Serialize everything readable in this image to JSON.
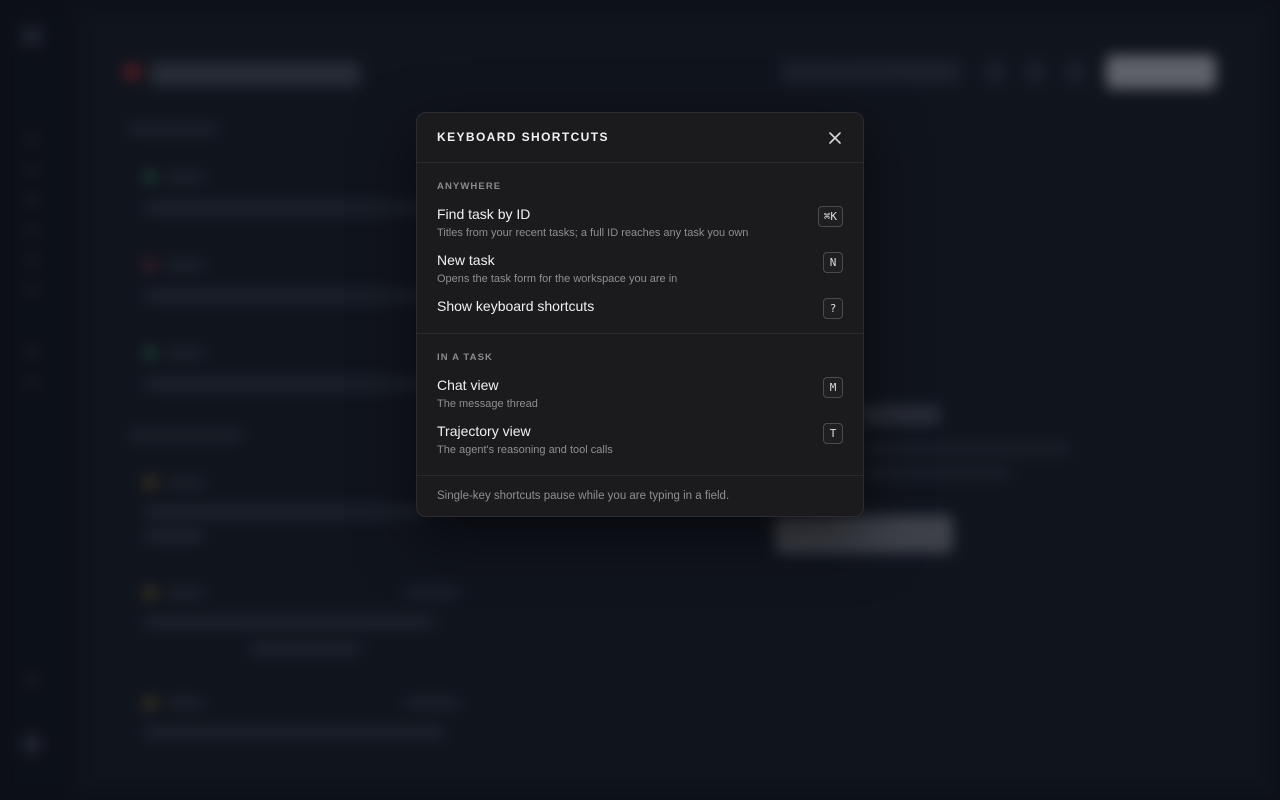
{
  "modal": {
    "title": "KEYBOARD SHORTCUTS",
    "close_icon": "close-icon",
    "sections": [
      {
        "label": "ANYWHERE",
        "items": [
          {
            "title": "Find task by ID",
            "description": "Titles from your recent tasks; a full ID reaches any task you own",
            "key": "⌘K"
          },
          {
            "title": "New task",
            "description": "Opens the task form for the workspace you are in",
            "key": "N"
          },
          {
            "title": "Show keyboard shortcuts",
            "description": "",
            "key": "?"
          }
        ]
      },
      {
        "label": "IN A TASK",
        "items": [
          {
            "title": "Chat view",
            "description": "The message thread",
            "key": "M"
          },
          {
            "title": "Trajectory view",
            "description": "The agent's reasoning and tool calls",
            "key": "T"
          }
        ]
      }
    ],
    "footer_note": "Single-key shortcuts pause while you are typing in a field."
  },
  "colors": {
    "modal_bg": "#1b1b1d",
    "backdrop": "#131821",
    "text_primary": "#f0f0f2",
    "text_secondary": "#8e8e94"
  }
}
